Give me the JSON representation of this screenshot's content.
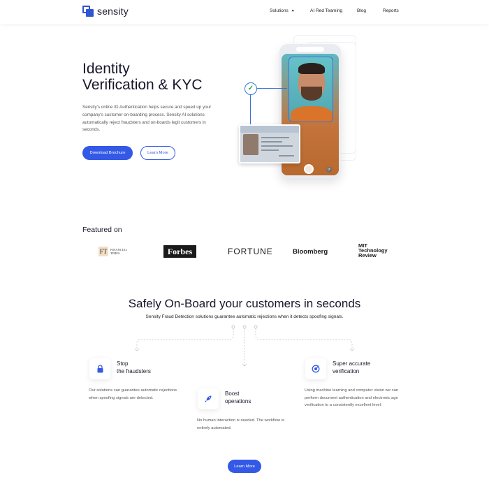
{
  "header": {
    "logo_text": "sensity",
    "nav": {
      "solutions": "Solutions",
      "ai_red_teaming": "AI Red Teaming",
      "blog": "Blog",
      "reports": "Reports"
    }
  },
  "hero": {
    "title_line1": "Identity",
    "title_line2": "Verification & KYC",
    "description": "Sensity's online ID Authentication helps secure and speed up your company's customer on-boarding process. Sensity AI solutions automatically reject fraudsters and on-boards legit customers in seconds.",
    "primary_button": "Download Brochure",
    "secondary_button": "Learn More"
  },
  "featured": {
    "title": "Featured on",
    "logos": {
      "ft_mark": "FT",
      "ft_line1": "FINANCIAL",
      "ft_line2": "TIMES",
      "forbes": "Forbes",
      "fortune": "FORTUNE",
      "bloomberg": "Bloomberg",
      "mit_line1": "MIT",
      "mit_line2": "Technology",
      "mit_line3": "Review"
    }
  },
  "onboard": {
    "title": "Safely On-Board your customers in seconds",
    "subtitle": "Sensity Fraud Detection solutions guarantee automatic rejections when it detects spoofing signals.",
    "features": [
      {
        "icon": "lock-icon",
        "title_line1": "Stop",
        "title_line2": "the fraudsters",
        "description": "Our solutions can guarantee automatic rejections when spoofing signals are detected."
      },
      {
        "icon": "rocket-icon",
        "title_line1": "Boost",
        "title_line2": "operations",
        "description": "No human interaction is needed. The workflow is entirely automated."
      },
      {
        "icon": "target-icon",
        "title_line1": "Super accurate",
        "title_line2": "verification",
        "description": "Using machine learning and computer vision we can perform document authentication and electronic age verification to a consistently excellent level."
      }
    ],
    "button": "Learn More"
  },
  "colors": {
    "accent": "#3459e6",
    "brand": "#2f55d4"
  }
}
